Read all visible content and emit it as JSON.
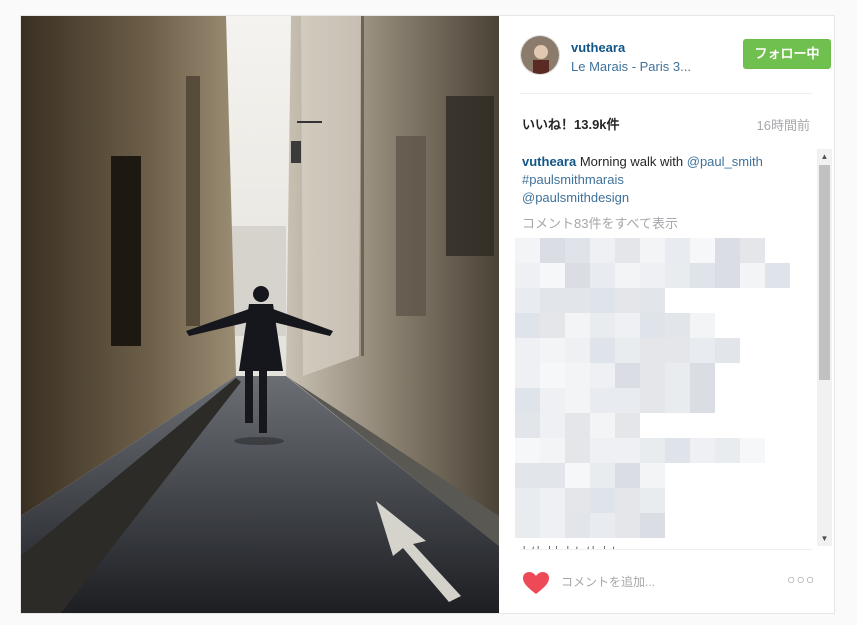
{
  "post": {
    "username": "vutheara",
    "location": "Le Marais - Paris 3...",
    "follow_label": "フォロー中",
    "likes_label": "いいね！13.9k件",
    "time_label": "16時間前",
    "caption": {
      "username": "vutheara",
      "text": " Morning walk with ",
      "mention1": "@paul_smith",
      "hashtag": "#paulsmithmarais",
      "mention2": "@paulsmithdesign"
    },
    "view_comments_label": "コメント83件をすべて表示",
    "partial_comment": "ﾄﾉﾄ ﾄﾄ ﾄﾉ ﾉﾄ ﾄﾉ",
    "comment_placeholder": "コメントを追加...",
    "more_options": "○○○"
  },
  "scrollbar": {
    "up": "▲",
    "down": "▼"
  },
  "colors": {
    "follow_button": "#70c050",
    "username": "#125688",
    "link": "#3f729b",
    "heart": "#ed4956"
  },
  "icons": {
    "heart": "heart-icon",
    "more": "ellipsis-icon"
  }
}
